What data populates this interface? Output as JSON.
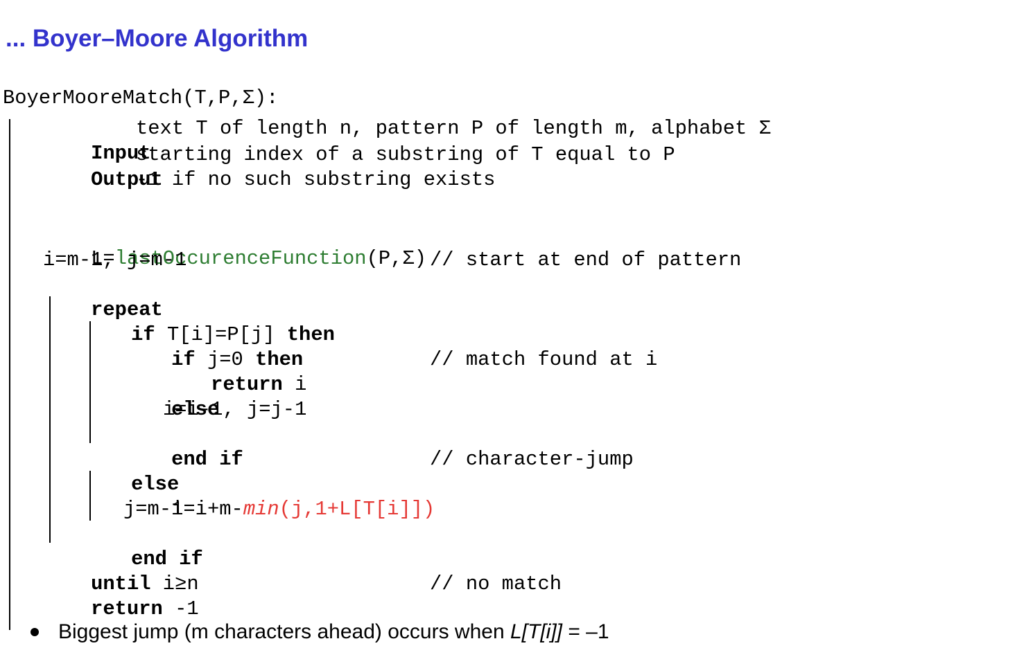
{
  "title": "... Boyer–Moore Algorithm",
  "code": {
    "signature": "BoyerMooreMatch(T,P,Σ):",
    "input_kw": "Input",
    "input_text": "text T of length n, pattern P of length m, alphabet Σ",
    "output_kw": "Output",
    "output_text": "starting index of a substring of T equal to P",
    "output_text2": "-1 if no such substring exists",
    "l_assign_prefix": "L=",
    "l_fn": "lastOccurenceFunction",
    "l_args": "(P,Σ)",
    "init": "i=m-1, j=m-1",
    "comment_start": "// start at end of pattern",
    "repeat_kw": "repeat",
    "if_kw": "if",
    "if_cond": " T[i]=P[j] ",
    "then_kw": "then",
    "if2_kw": "if",
    "if2_cond": " j=0 ",
    "then2_kw": "then",
    "return_kw": "return",
    "return_var": " i",
    "comment_match": "// match found at i",
    "else_kw": "else",
    "dec": "i=i-1, j=j-1",
    "endif_kw": "end if",
    "else2_kw": "else",
    "comment_jump": "// character-jump",
    "jump_prefix": "i=i+m-",
    "jump_min": "min",
    "jump_args": "(j,1+L[T[i]])",
    "reset_j": "j=m-1",
    "endif2_kw": "end if",
    "until_kw": "until",
    "until_cond": " i≥n",
    "return2_kw": "return",
    "return2_val": " -1",
    "comment_nomatch": "// no match"
  },
  "bullet": {
    "text": "Biggest jump (m characters ahead) occurs when ",
    "math": "L[T[i]]",
    "tail": " = –1"
  }
}
